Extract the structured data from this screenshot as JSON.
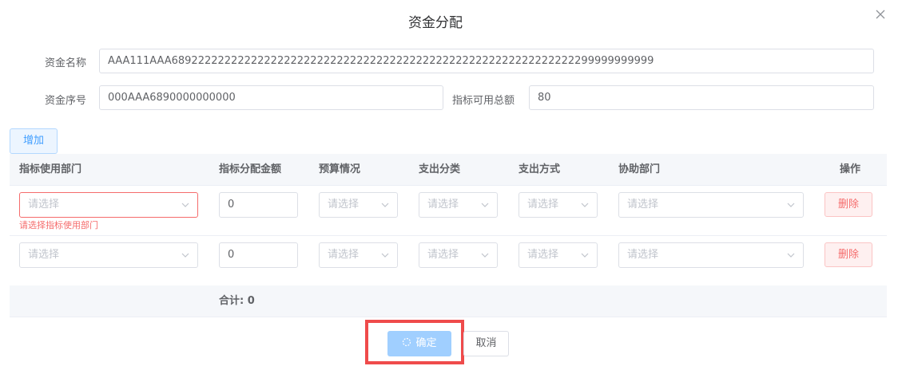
{
  "dialog": {
    "title": "资金分配"
  },
  "form": {
    "fund_name_label": "资金名称",
    "fund_name_value": "AAA111AAA6892222222222222222222222222222222222222222222222222222222222299999999999",
    "fund_no_label": "资金序号",
    "fund_no_value": "000AAA6890000000000",
    "available_total_label": "指标可用总额",
    "available_total_value": "80"
  },
  "toolbar": {
    "add_label": "增加"
  },
  "table": {
    "headers": [
      "指标使用部门",
      "指标分配金额",
      "预算情况",
      "支出分类",
      "支出方式",
      "协助部门",
      "操作"
    ],
    "select_placeholder": "请选择",
    "rows": [
      {
        "amount": "0",
        "error": "请选择指标使用部门",
        "delete_label": "删除"
      },
      {
        "amount": "0",
        "delete_label": "删除"
      }
    ],
    "total_label": "合计: 0"
  },
  "footer": {
    "confirm_label": "确定",
    "cancel_label": "取消"
  },
  "colors": {
    "primary_light": "#a0cfff",
    "error": "#f56c6c",
    "highlight_box": "#ef4b4b"
  }
}
